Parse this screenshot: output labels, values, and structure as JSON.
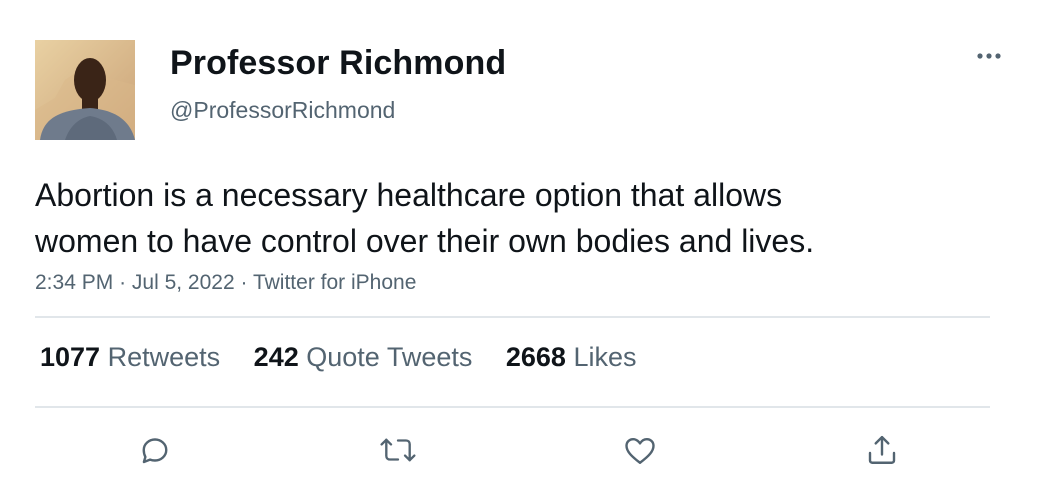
{
  "author": {
    "display_name": "Professor Richmond",
    "handle": "@ProfessorRichmond",
    "avatar_icon": "profile-photo"
  },
  "tweet": {
    "text_lines": [
      "Abortion is a necessary healthcare option that allows",
      "women to have control over their own bodies and lives."
    ],
    "time": "2:34 PM",
    "date": "Jul 5, 2022",
    "source": "Twitter for iPhone",
    "separator": "·"
  },
  "stats": {
    "retweets": {
      "count": "1077",
      "label": "Retweets"
    },
    "quotes": {
      "count": "242",
      "label": "Quote Tweets"
    },
    "likes": {
      "count": "2668",
      "label": "Likes"
    }
  },
  "actions": [
    "reply-icon",
    "retweet-icon",
    "like-icon",
    "share-icon"
  ],
  "colors": {
    "text": "#0f1419",
    "secondary": "#536471",
    "divider": "#e1e6ea"
  }
}
